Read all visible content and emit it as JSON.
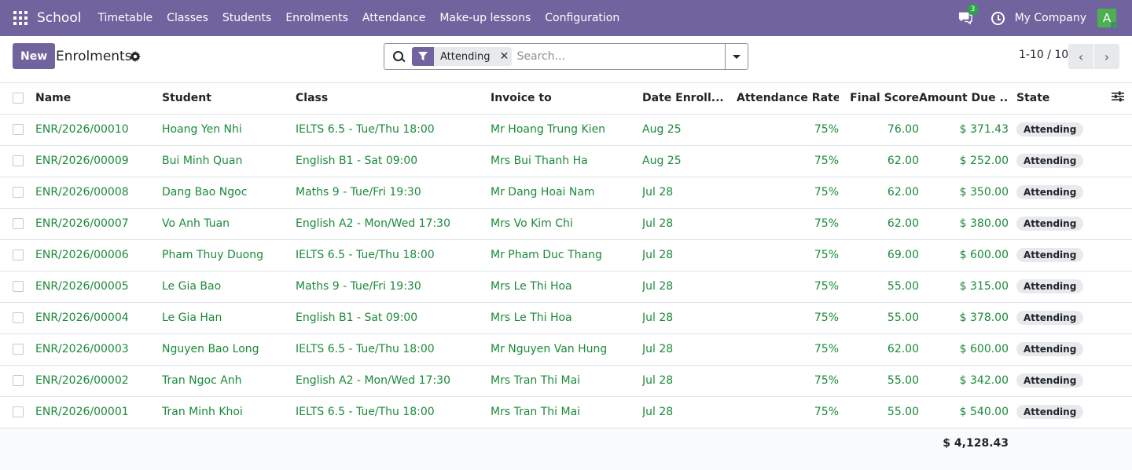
{
  "app": {
    "name": "School",
    "menu": [
      "Timetable",
      "Classes",
      "Students",
      "Enrolments",
      "Attendance",
      "Make-up lessons",
      "Configuration"
    ],
    "message_count": "3",
    "company": "My Company",
    "avatar_letter": "A"
  },
  "control": {
    "new_label": "New",
    "title": "Enrolments",
    "facet": "Attending",
    "search_placeholder": "Search...",
    "pager": "1-10 / 10"
  },
  "table": {
    "columns": [
      "Name",
      "Student",
      "Class",
      "Invoice to",
      "Date Enroll...",
      "Attendance Rate",
      "Final Score",
      "Amount Due ...",
      "State"
    ],
    "rows": [
      {
        "name": "ENR/2026/00010",
        "student": "Hoang Yen Nhi",
        "class": "IELTS 6.5 - Tue/Thu 18:00",
        "invoice": "Mr Hoang Trung Kien",
        "date": "Aug 25",
        "rate": "75%",
        "score": "76.00",
        "amount": "$ 371.43",
        "state": "Attending"
      },
      {
        "name": "ENR/2026/00009",
        "student": "Bui Minh Quan",
        "class": "English B1 - Sat 09:00",
        "invoice": "Mrs Bui Thanh Ha",
        "date": "Aug 25",
        "rate": "75%",
        "score": "62.00",
        "amount": "$ 252.00",
        "state": "Attending"
      },
      {
        "name": "ENR/2026/00008",
        "student": "Dang Bao Ngoc",
        "class": "Maths 9 - Tue/Fri 19:30",
        "invoice": "Mr Dang Hoai Nam",
        "date": "Jul 28",
        "rate": "75%",
        "score": "62.00",
        "amount": "$ 350.00",
        "state": "Attending"
      },
      {
        "name": "ENR/2026/00007",
        "student": "Vo Anh Tuan",
        "class": "English A2 - Mon/Wed 17:30",
        "invoice": "Mrs Vo Kim Chi",
        "date": "Jul 28",
        "rate": "75%",
        "score": "62.00",
        "amount": "$ 380.00",
        "state": "Attending"
      },
      {
        "name": "ENR/2026/00006",
        "student": "Pham Thuy Duong",
        "class": "IELTS 6.5 - Tue/Thu 18:00",
        "invoice": "Mr Pham Duc Thang",
        "date": "Jul 28",
        "rate": "75%",
        "score": "69.00",
        "amount": "$ 600.00",
        "state": "Attending"
      },
      {
        "name": "ENR/2026/00005",
        "student": "Le Gia Bao",
        "class": "Maths 9 - Tue/Fri 19:30",
        "invoice": "Mrs Le Thi Hoa",
        "date": "Jul 28",
        "rate": "75%",
        "score": "55.00",
        "amount": "$ 315.00",
        "state": "Attending"
      },
      {
        "name": "ENR/2026/00004",
        "student": "Le Gia Han",
        "class": "English B1 - Sat 09:00",
        "invoice": "Mrs Le Thi Hoa",
        "date": "Jul 28",
        "rate": "75%",
        "score": "55.00",
        "amount": "$ 378.00",
        "state": "Attending"
      },
      {
        "name": "ENR/2026/00003",
        "student": "Nguyen Bao Long",
        "class": "IELTS 6.5 - Tue/Thu 18:00",
        "invoice": "Mr Nguyen Van Hung",
        "date": "Jul 28",
        "rate": "75%",
        "score": "62.00",
        "amount": "$ 600.00",
        "state": "Attending"
      },
      {
        "name": "ENR/2026/00002",
        "student": "Tran Ngoc Anh",
        "class": "English A2 - Mon/Wed 17:30",
        "invoice": "Mrs Tran Thi Mai",
        "date": "Jul 28",
        "rate": "75%",
        "score": "55.00",
        "amount": "$ 342.00",
        "state": "Attending"
      },
      {
        "name": "ENR/2026/00001",
        "student": "Tran Minh Khoi",
        "class": "IELTS 6.5 - Tue/Thu 18:00",
        "invoice": "Mrs Tran Thi Mai",
        "date": "Jul 28",
        "rate": "75%",
        "score": "55.00",
        "amount": "$ 540.00",
        "state": "Attending"
      }
    ],
    "total_amount": "$ 4,128.43"
  }
}
